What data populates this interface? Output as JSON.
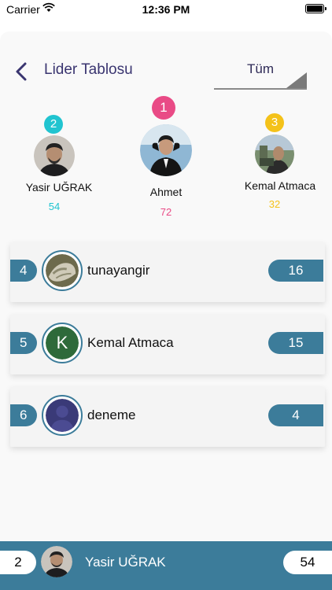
{
  "status": {
    "carrier": "Carrier",
    "time": "12:36 PM"
  },
  "header": {
    "title": "Lider Tablosu",
    "filter": "Tüm"
  },
  "colors": {
    "accent": "#3c7c9a",
    "first": "#e94b86",
    "second": "#21c4d0",
    "third": "#f4c21a",
    "title": "#3a3570"
  },
  "podium": {
    "first": {
      "rank": "1",
      "name": "Ahmet",
      "score": "72"
    },
    "second": {
      "rank": "2",
      "name": "Yasir UĞRAK",
      "score": "54"
    },
    "third": {
      "rank": "3",
      "name": "Kemal Atmaca",
      "score": "32"
    }
  },
  "list": [
    {
      "rank": "4",
      "name": "tunayangir",
      "score": "16",
      "avatar": "photo"
    },
    {
      "rank": "5",
      "name": "Kemal Atmaca",
      "score": "15",
      "avatar": "letter",
      "letter": "K"
    },
    {
      "rank": "6",
      "name": "deneme",
      "score": "4",
      "avatar": "default"
    }
  ],
  "me": {
    "rank": "2",
    "name": "Yasir UĞRAK",
    "score": "54"
  }
}
